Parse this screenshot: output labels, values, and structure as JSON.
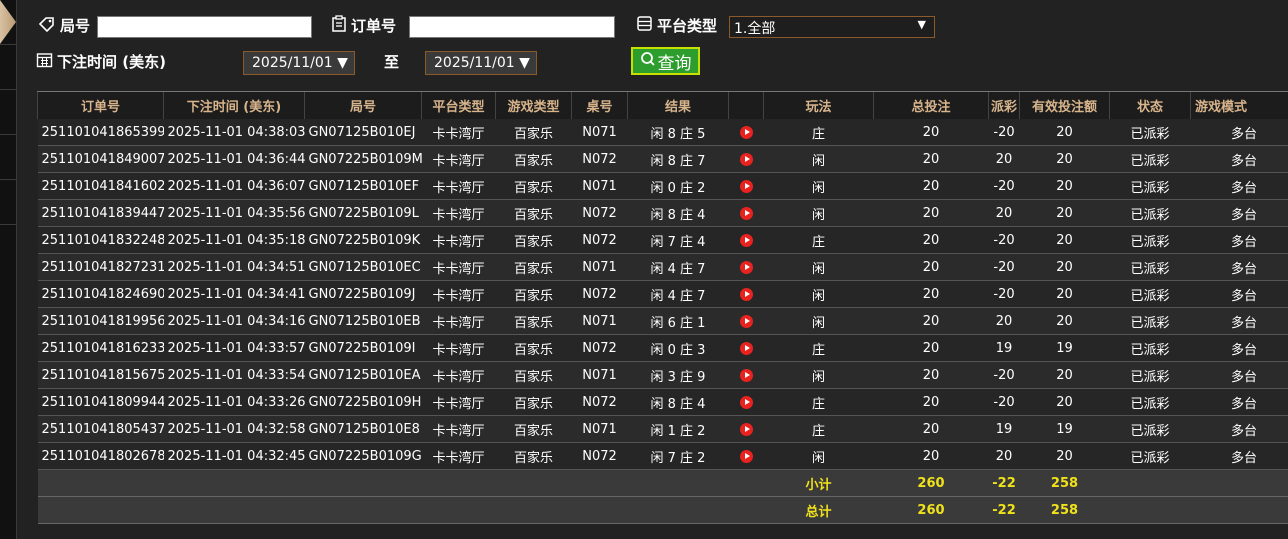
{
  "filters": {
    "round_label": "局号",
    "round_value": "",
    "order_label": "订单号",
    "order_value": "",
    "platform_label": "平台类型",
    "platform_selected": "1.全部",
    "time_label": "下注时间 (美东)",
    "date_from": "2025/11/01",
    "to_label": "至",
    "date_to": "2025/11/01",
    "query_label": "查询"
  },
  "table": {
    "headers": [
      "订单号",
      "下注时间 (美东)",
      "局号",
      "平台类型",
      "游戏类型",
      "桌号",
      "结果",
      "玩法",
      "总投注",
      "派彩",
      "有效投注额",
      "状态",
      "游戏模式"
    ],
    "rows": [
      {
        "order": "251101041865399",
        "time": "2025-11-01 04:38:03",
        "round": "GN07125B010EJ",
        "platform": "卡卡湾厅",
        "game": "百家乐",
        "table": "N071",
        "result": "闲 8 庄 5",
        "play": "庄",
        "bet": "20",
        "payout": "-20",
        "valid": "20",
        "status": "已派彩",
        "mode": "多台"
      },
      {
        "order": "251101041849007",
        "time": "2025-11-01 04:36:44",
        "round": "GN07225B0109M",
        "platform": "卡卡湾厅",
        "game": "百家乐",
        "table": "N072",
        "result": "闲 8 庄 7",
        "play": "闲",
        "bet": "20",
        "payout": "20",
        "valid": "20",
        "status": "已派彩",
        "mode": "多台"
      },
      {
        "order": "251101041841602",
        "time": "2025-11-01 04:36:07",
        "round": "GN07125B010EF",
        "platform": "卡卡湾厅",
        "game": "百家乐",
        "table": "N071",
        "result": "闲 0 庄 2",
        "play": "闲",
        "bet": "20",
        "payout": "-20",
        "valid": "20",
        "status": "已派彩",
        "mode": "多台"
      },
      {
        "order": "251101041839447",
        "time": "2025-11-01 04:35:56",
        "round": "GN07225B0109L",
        "platform": "卡卡湾厅",
        "game": "百家乐",
        "table": "N072",
        "result": "闲 8 庄 4",
        "play": "闲",
        "bet": "20",
        "payout": "20",
        "valid": "20",
        "status": "已派彩",
        "mode": "多台"
      },
      {
        "order": "251101041832248",
        "time": "2025-11-01 04:35:18",
        "round": "GN07225B0109K",
        "platform": "卡卡湾厅",
        "game": "百家乐",
        "table": "N072",
        "result": "闲 7 庄 4",
        "play": "庄",
        "bet": "20",
        "payout": "-20",
        "valid": "20",
        "status": "已派彩",
        "mode": "多台"
      },
      {
        "order": "251101041827231",
        "time": "2025-11-01 04:34:51",
        "round": "GN07125B010EC",
        "platform": "卡卡湾厅",
        "game": "百家乐",
        "table": "N071",
        "result": "闲 4 庄 7",
        "play": "闲",
        "bet": "20",
        "payout": "-20",
        "valid": "20",
        "status": "已派彩",
        "mode": "多台"
      },
      {
        "order": "251101041824690",
        "time": "2025-11-01 04:34:41",
        "round": "GN07225B0109J",
        "platform": "卡卡湾厅",
        "game": "百家乐",
        "table": "N072",
        "result": "闲 4 庄 7",
        "play": "闲",
        "bet": "20",
        "payout": "-20",
        "valid": "20",
        "status": "已派彩",
        "mode": "多台"
      },
      {
        "order": "251101041819956",
        "time": "2025-11-01 04:34:16",
        "round": "GN07125B010EB",
        "platform": "卡卡湾厅",
        "game": "百家乐",
        "table": "N071",
        "result": "闲 6 庄 1",
        "play": "闲",
        "bet": "20",
        "payout": "20",
        "valid": "20",
        "status": "已派彩",
        "mode": "多台"
      },
      {
        "order": "251101041816233",
        "time": "2025-11-01 04:33:57",
        "round": "GN07225B0109I",
        "platform": "卡卡湾厅",
        "game": "百家乐",
        "table": "N072",
        "result": "闲 0 庄 3",
        "play": "庄",
        "bet": "20",
        "payout": "19",
        "valid": "19",
        "status": "已派彩",
        "mode": "多台"
      },
      {
        "order": "251101041815675",
        "time": "2025-11-01 04:33:54",
        "round": "GN07125B010EA",
        "platform": "卡卡湾厅",
        "game": "百家乐",
        "table": "N071",
        "result": "闲 3 庄 9",
        "play": "闲",
        "bet": "20",
        "payout": "-20",
        "valid": "20",
        "status": "已派彩",
        "mode": "多台"
      },
      {
        "order": "251101041809944",
        "time": "2025-11-01 04:33:26",
        "round": "GN07225B0109H",
        "platform": "卡卡湾厅",
        "game": "百家乐",
        "table": "N072",
        "result": "闲 8 庄 4",
        "play": "庄",
        "bet": "20",
        "payout": "-20",
        "valid": "20",
        "status": "已派彩",
        "mode": "多台"
      },
      {
        "order": "251101041805437",
        "time": "2025-11-01 04:32:58",
        "round": "GN07125B010E8",
        "platform": "卡卡湾厅",
        "game": "百家乐",
        "table": "N071",
        "result": "闲 1 庄 2",
        "play": "庄",
        "bet": "20",
        "payout": "19",
        "valid": "19",
        "status": "已派彩",
        "mode": "多台"
      },
      {
        "order": "251101041802678",
        "time": "2025-11-01 04:32:45",
        "round": "GN07225B0109G",
        "platform": "卡卡湾厅",
        "game": "百家乐",
        "table": "N072",
        "result": "闲 7 庄 2",
        "play": "闲",
        "bet": "20",
        "payout": "20",
        "valid": "20",
        "status": "已派彩",
        "mode": "多台"
      }
    ],
    "subtotal": {
      "label": "小计",
      "bet": "260",
      "payout": "-22",
      "valid": "258"
    },
    "total": {
      "label": "总计",
      "bet": "260",
      "payout": "-22",
      "valid": "258"
    }
  },
  "colors": {
    "header_text": "#d7b48b",
    "payout_negative": "#2fcf2f",
    "payout_positive": "#e0242c",
    "status": "#1fd01f",
    "summary": "#f0e21a"
  }
}
